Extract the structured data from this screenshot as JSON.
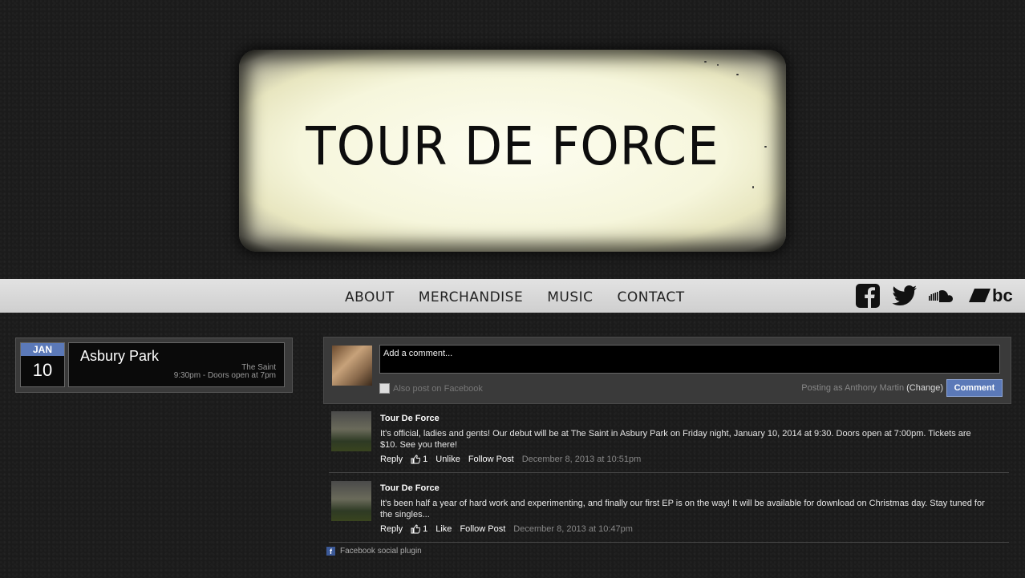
{
  "banner": {
    "title": "TOUR DE FORCE"
  },
  "nav": {
    "links": [
      "ABOUT",
      "MERCHANDISE",
      "MUSIC",
      "CONTACT"
    ],
    "social": [
      "facebook-icon",
      "twitter-icon",
      "soundcloud-icon",
      "bandcamp-icon"
    ],
    "bandcamp_text": "bc"
  },
  "event": {
    "month": "JAN",
    "day": "10",
    "city": "Asbury Park",
    "venue": "The Saint",
    "time": "9:30pm - Doors open at 7pm"
  },
  "comment_box": {
    "placeholder": "Add a comment...",
    "also_post": "Also post on Facebook",
    "posting_as_prefix": "Posting as Anthony Martin",
    "change": "(Change)",
    "button": "Comment"
  },
  "posts": [
    {
      "author": "Tour De Force",
      "text": "It's official, ladies and gents! Our debut will be at The Saint in Asbury Park on Friday night, January 10, 2014 at 9:30. Doors open at 7:00pm. Tickets are $10. See you there!",
      "reply": "Reply",
      "likes": "1",
      "like_action": "Unlike",
      "follow": "Follow Post",
      "timestamp": "December 8, 2013 at 10:51pm"
    },
    {
      "author": "Tour De Force",
      "text": "It's been half a year of hard work and experimenting, and finally our first EP is on the way! It will be available for download on Christmas day. Stay tuned for the singles...",
      "reply": "Reply",
      "likes": "1",
      "like_action": "Like",
      "follow": "Follow Post",
      "timestamp": "December 8, 2013 at 10:47pm"
    }
  ],
  "footer": {
    "plugin": "Facebook social plugin"
  },
  "colors": {
    "accent": "#5b79b8",
    "nav_bg": "#d9d9d9",
    "page_bg": "#1b1b1b"
  }
}
